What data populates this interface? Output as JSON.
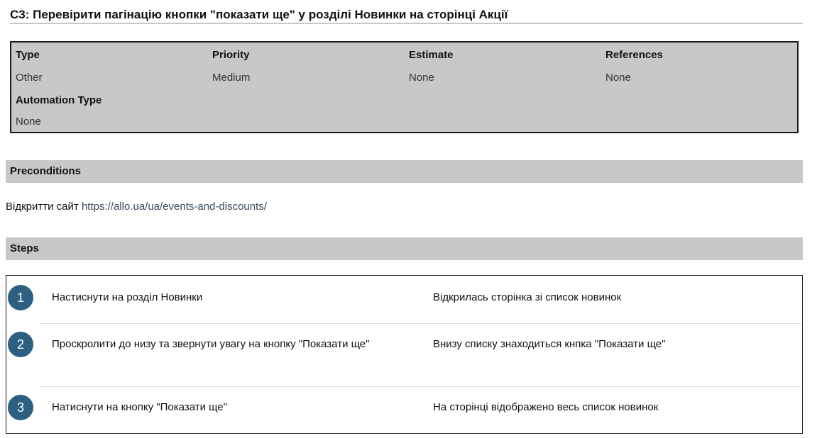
{
  "case": {
    "title": "C3: Перевірити пагінацію кнопки \"показати ще\" у розділі Новинки на сторінці Акції"
  },
  "meta": {
    "type_label": "Type",
    "type_value": "Other",
    "priority_label": "Priority",
    "priority_value": "Medium",
    "estimate_label": "Estimate",
    "estimate_value": "None",
    "references_label": "References",
    "references_value": "None",
    "automation_label": "Automation Type",
    "automation_value": "None"
  },
  "preconditions": {
    "header": "Preconditions",
    "text": "Відкритти сайт",
    "link": "https://allo.ua/ua/events-and-discounts/"
  },
  "steps": {
    "header": "Steps",
    "items": [
      {
        "number": "1",
        "action": "Настиснути на розділ Новинки",
        "expected": "Відкрилась сторінка зі список новинок"
      },
      {
        "number": "2",
        "action": "Проскролити до низу та звернути увагу на кнопку \"Показати ще\"",
        "expected": "Внизу списку знаходиться кнпка \"Показати ще\""
      },
      {
        "number": "3",
        "action": "Натиснути на кнопку \"Показати ще\"",
        "expected": "На сторінці відображено весь список новинок"
      }
    ]
  }
}
